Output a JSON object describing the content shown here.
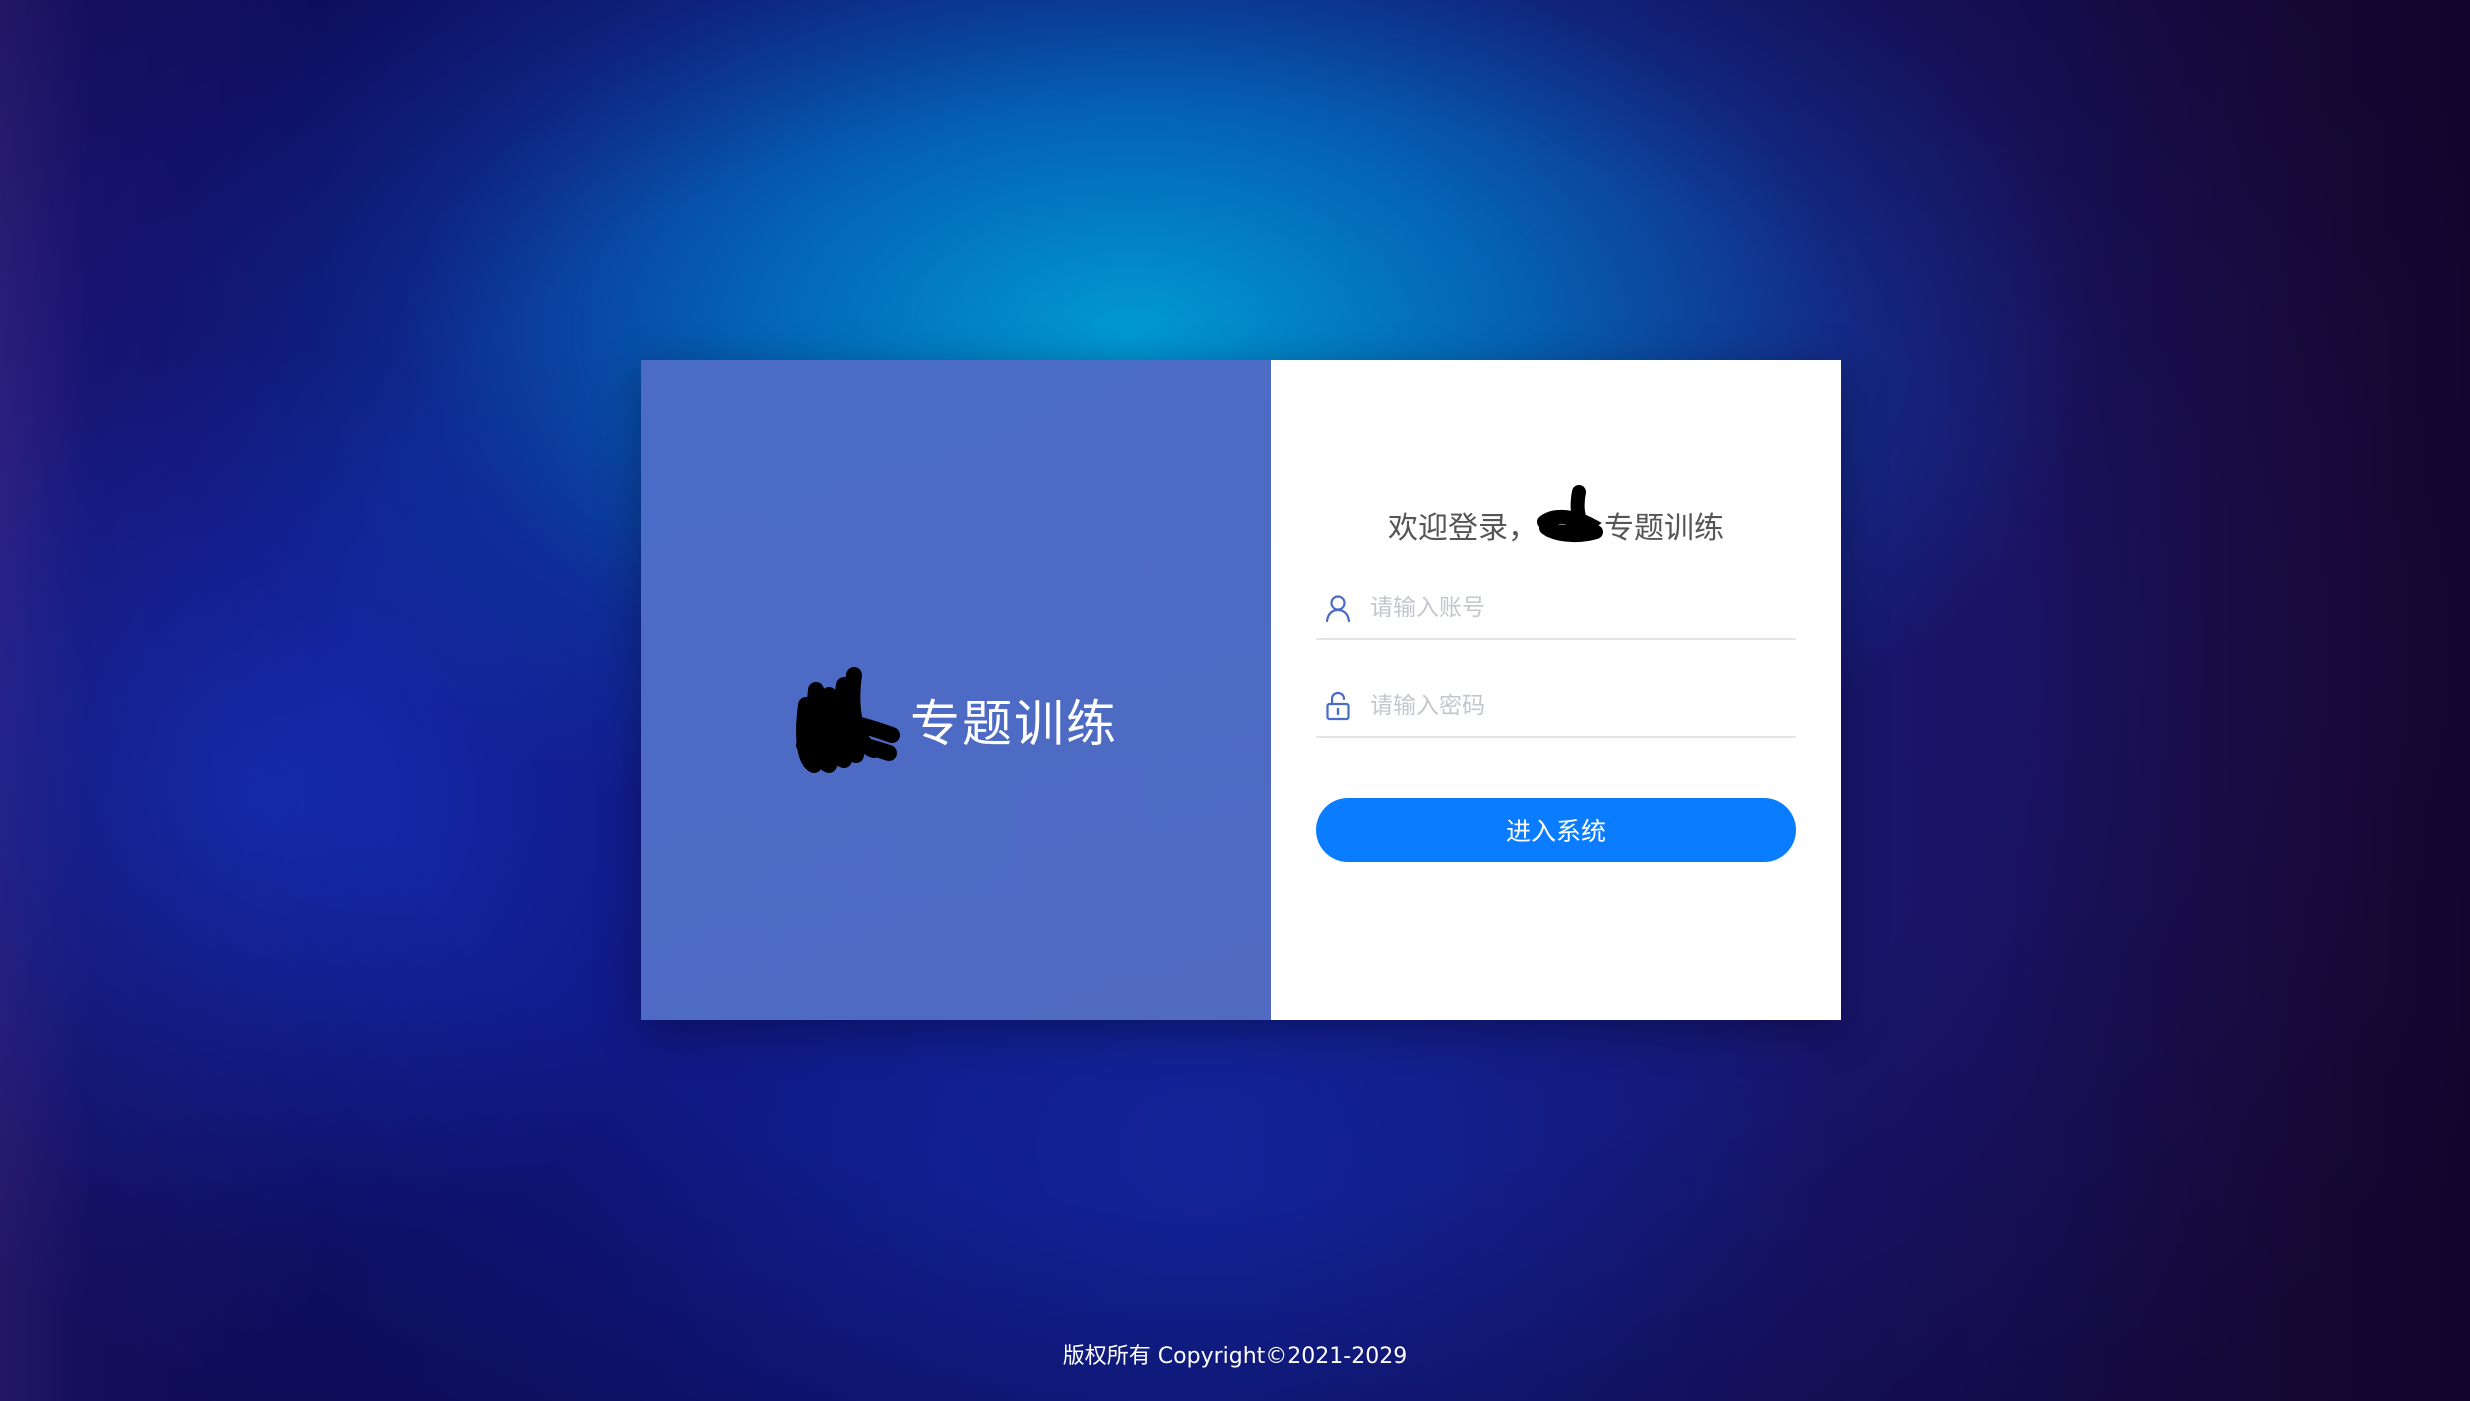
{
  "brand": {
    "title": "专题训练"
  },
  "login": {
    "welcome_prefix": "欢迎登录，",
    "welcome_suffix": "专题训练",
    "username_placeholder": "请输入账号",
    "password_placeholder": "请输入密码",
    "submit_label": "进入系统"
  },
  "footer": {
    "copyright": "版权所有 Copyright©2021-2029"
  },
  "icons": {
    "username": "user-icon",
    "password": "lock-icon"
  },
  "colors": {
    "left_panel": "#4a6cc7",
    "button": "#0a7cff",
    "welcome_text": "#555555",
    "placeholder": "#c3c6cc"
  }
}
